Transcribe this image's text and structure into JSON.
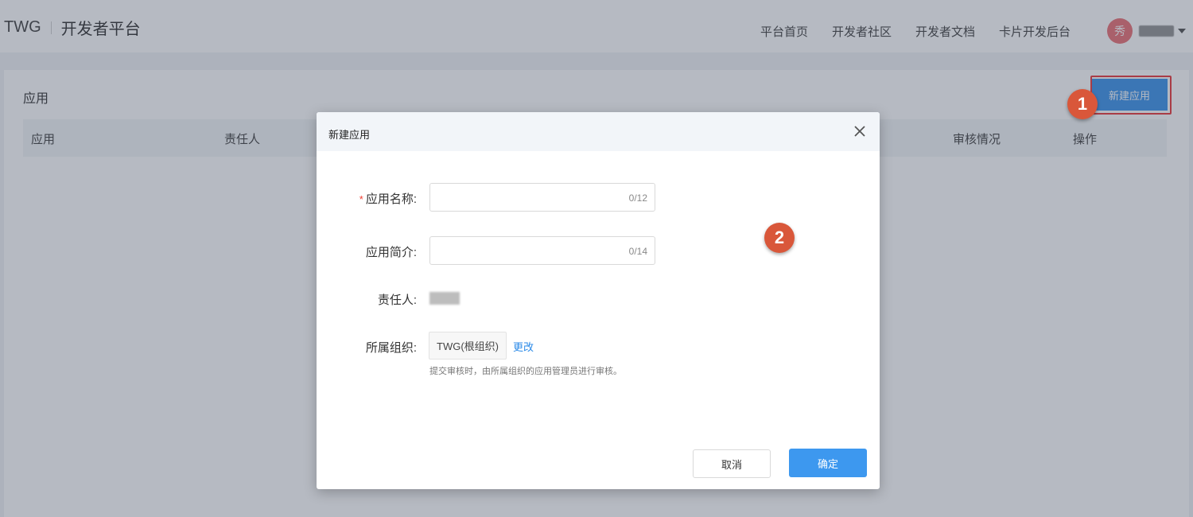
{
  "header": {
    "brand": "TWG",
    "title": "开发者平台",
    "nav": [
      {
        "label": "平台首页"
      },
      {
        "label": "开发者社区"
      },
      {
        "label": "开发者文档"
      },
      {
        "label": "卡片开发后台"
      }
    ],
    "avatar_text": "秀"
  },
  "main": {
    "title": "应用",
    "new_app_label": "新建应用",
    "table_headers": [
      "应用",
      "责任人",
      "审核情况",
      "操作"
    ]
  },
  "markers": [
    "1",
    "2"
  ],
  "dialog": {
    "title": "新建应用",
    "fields": {
      "name": {
        "label": "应用名称:",
        "required_mark": "*",
        "value": "",
        "counter": "0/12"
      },
      "intro": {
        "label": "应用简介:",
        "value": "",
        "counter": "0/14"
      },
      "owner": {
        "label": "责任人:"
      },
      "org": {
        "label": "所属组织:",
        "value": "TWG(根组织)",
        "change_label": "更改",
        "hint": "提交审核时，由所属组织的应用管理员进行审核。"
      }
    },
    "cancel_label": "取消",
    "confirm_label": "确定"
  },
  "colors": {
    "primary": "#2b8ae8",
    "marker": "#d9573a",
    "highlight_box": "#e8272a",
    "avatar": "#e8646a"
  },
  "icons": {
    "close": "close-icon",
    "dropdown": "caret-down-icon"
  }
}
